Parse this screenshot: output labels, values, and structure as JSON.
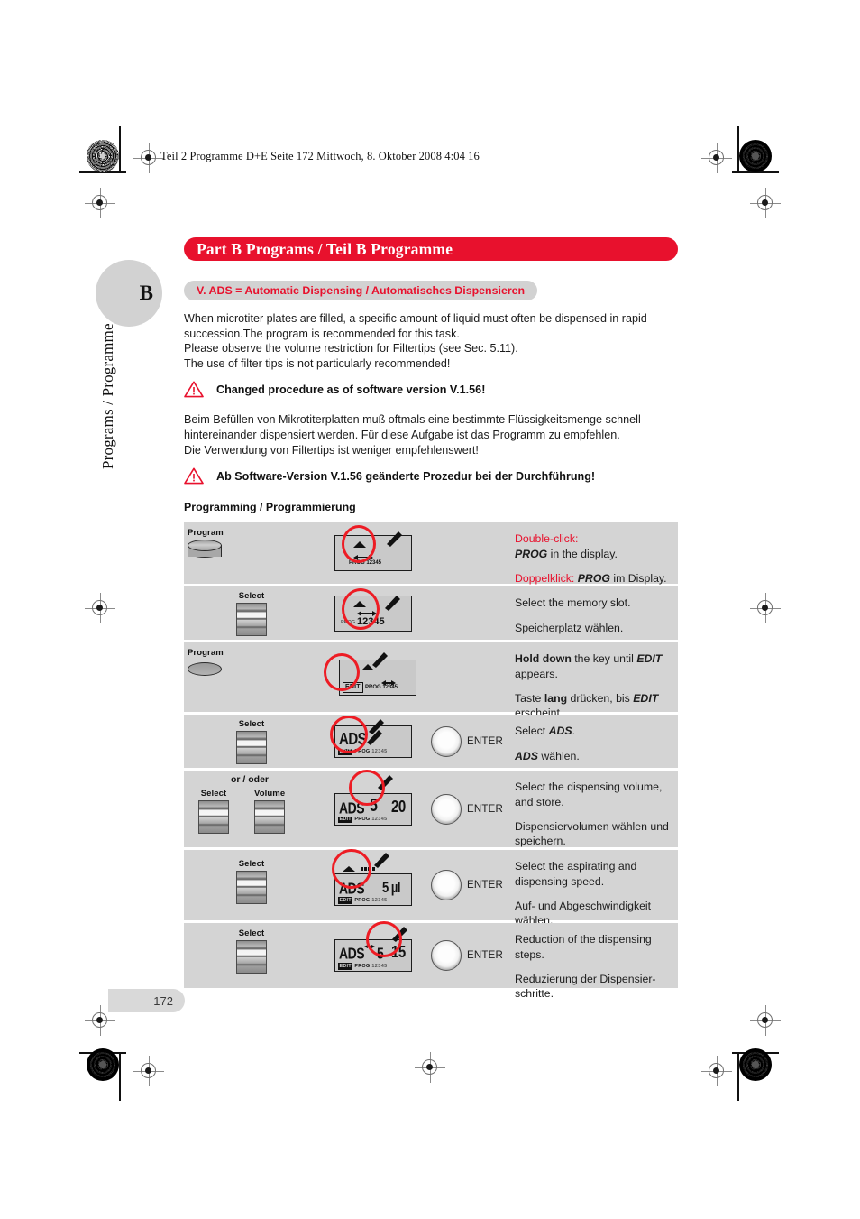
{
  "print_header": "Teil 2 Programme D+E  Seite 172  Mittwoch, 8. Oktober 2008  4:04 16",
  "margin": {
    "section_letter": "B",
    "vertical_title": "Programs / Programme",
    "page_number": "172"
  },
  "banner": {
    "title": "Part B  Programs / Teil B  Programme",
    "color": "#e8112d"
  },
  "subbanner": {
    "title": "V.  ADS = Automatic Dispensing / Automatisches Dispensieren",
    "text_color": "#e8112d",
    "bg_color": "#d2d2d2"
  },
  "intro_en": {
    "line1": "When microtiter plates are filled, a specific amount of liquid must often be dispensed in rapid",
    "line2": "succession.The program is recommended for this task.",
    "line3": "Please observe the volume restriction for Filtertips (see Sec. 5.11).",
    "line4": "The use of filter tips is not particularly recommended!"
  },
  "warning_en": "Changed procedure as of software version V.1.56!",
  "intro_de": {
    "line1": "Beim Befüllen von Mikrotiterplatten muß oftmals eine bestimmte Flüssigkeitsmenge schnell",
    "line2": "hintereinander dispensiert werden. Für diese Aufgabe ist das Programm zu empfehlen.",
    "line3": "Die Verwendung von Filtertips ist weniger empfehlenswert!"
  },
  "warning_de": "Ab Software-Version V.1.56 geänderte Prozedur bei der Durchführung!",
  "programming_heading": "Programming / Programmierung",
  "enter_label": "ENTER",
  "or_label": "or / oder",
  "steps": [
    {
      "key_label": "Program",
      "key_type": "program-knob",
      "display": {
        "kind": "panel",
        "seg_text": "PROG 12345",
        "edit_chip": "",
        "highlight": "double-arrow"
      },
      "has_enter": false,
      "text_en_prefix": "Double-click",
      "text_en": ":",
      "text_en_line2_bold": "PROG",
      "text_en_line2": " in the display.",
      "text_de_prefix": "Doppelklick",
      "text_de_bold": "PROG",
      "text_de": " im Display."
    },
    {
      "key_label": "Select",
      "key_type": "rocker",
      "display": {
        "kind": "panel",
        "seg_text": "PROG",
        "big_number": "12345",
        "highlight": "number"
      },
      "has_enter": false,
      "text_en": "Select the memory slot.",
      "text_de": "Speicherplatz wählen."
    },
    {
      "key_label": "Program",
      "key_type": "program-knob-flat",
      "display": {
        "kind": "panel",
        "edit_chip": "EDIT",
        "seg_text": "PROG 12345",
        "highlight": "edit"
      },
      "has_enter": false,
      "text_en_bold": "Hold down",
      "text_en_mid": " the key until ",
      "text_en_bolditalic": "EDIT",
      "text_en_end": " appears.",
      "text_de_start": "Taste ",
      "text_de_bold": "lang",
      "text_de_mid": " drücken, bis ",
      "text_de_bolditalic": "EDIT",
      "text_de_end": " erscheint."
    },
    {
      "key_label": "Select",
      "key_type": "rocker",
      "display": {
        "kind": "lcd",
        "seg_main": "ADS",
        "edit_chip": "EDIT",
        "prog_chip": "PROG",
        "prog_nums": "12345",
        "highlight": "ads"
      },
      "has_enter": true,
      "text_en_start": "Select ",
      "text_en_bolditalic": "ADS",
      "text_en_end": ".",
      "text_de_bolditalic": "ADS",
      "text_de_end": " wählen."
    },
    {
      "key_label_1": "Select",
      "key_label_2": "Volume",
      "key_type": "rocker-pair",
      "or_label": "or / oder",
      "display": {
        "kind": "lcd",
        "seg_main": "ADS",
        "seg_mid": "5",
        "seg_right": "20",
        "edit_chip": "EDIT",
        "prog_chip": "PROG",
        "prog_nums": "12345",
        "highlight": "mid"
      },
      "has_enter": true,
      "text_en": "Select the dispensing volume, and store.",
      "text_de": "Dispensiervolumen wählen und speichern."
    },
    {
      "key_label": "Select",
      "key_type": "rocker",
      "display": {
        "kind": "lcd",
        "seg_main": "ADS",
        "seg_right": "5 µl",
        "edit_chip": "EDIT",
        "prog_chip": "PROG",
        "prog_nums": "12345",
        "highlight": "speed"
      },
      "has_enter": true,
      "text_en": "Select the aspirating and dispensing speed.",
      "text_de": "Auf- und Abgeschwindigkeit wählen."
    },
    {
      "key_label": "Select",
      "key_type": "rocker",
      "display": {
        "kind": "lcd",
        "seg_main": "ADS",
        "seg_mid": "5",
        "seg_right": "15",
        "edit_chip": "EDIT",
        "prog_chip": "PROG",
        "prog_nums": "12345",
        "highlight": "right"
      },
      "has_enter": true,
      "text_en": "Reduction of the dispensing steps.",
      "text_de": "Reduzierung der Dispensier- schritte."
    }
  ]
}
